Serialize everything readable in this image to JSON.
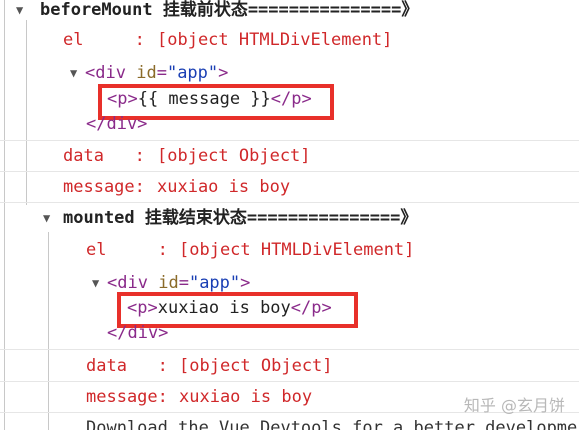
{
  "console": {
    "before_mount": {
      "title": "beforeMount 挂载前状态===============》",
      "el_label": "el     : ",
      "el_value": "[object HTMLDivElement]",
      "div_open_tag": "div",
      "div_attr_name": "id",
      "div_attr_value": "\"app\"",
      "p_content": "{{ message }}",
      "div_close": "</div>",
      "data_label": "data   : ",
      "data_value": "[object Object]",
      "message_label": "message: ",
      "message_value": "xuxiao is boy"
    },
    "mounted": {
      "title": "mounted 挂载结束状态===============》",
      "el_label": "el     : ",
      "el_value": "[object HTMLDivElement]",
      "div_open_tag": "div",
      "div_attr_name": "id",
      "div_attr_value": "\"app\"",
      "p_content": "xuxiao is boy",
      "div_close": "</div>",
      "data_label": "data   : ",
      "data_value": "[object Object]",
      "message_label": "message: ",
      "message_value": "xuxiao is boy"
    },
    "devtools_notice": "Download the Vue Devtools for a better developme"
  },
  "watermark": "知乎 @玄月饼",
  "tags": {
    "p_open": "<p>",
    "p_close": "</p>",
    "lt": "<",
    "gt": ">",
    "eq": "="
  },
  "icons": {
    "expand_triangle": "triangle-down-icon"
  }
}
